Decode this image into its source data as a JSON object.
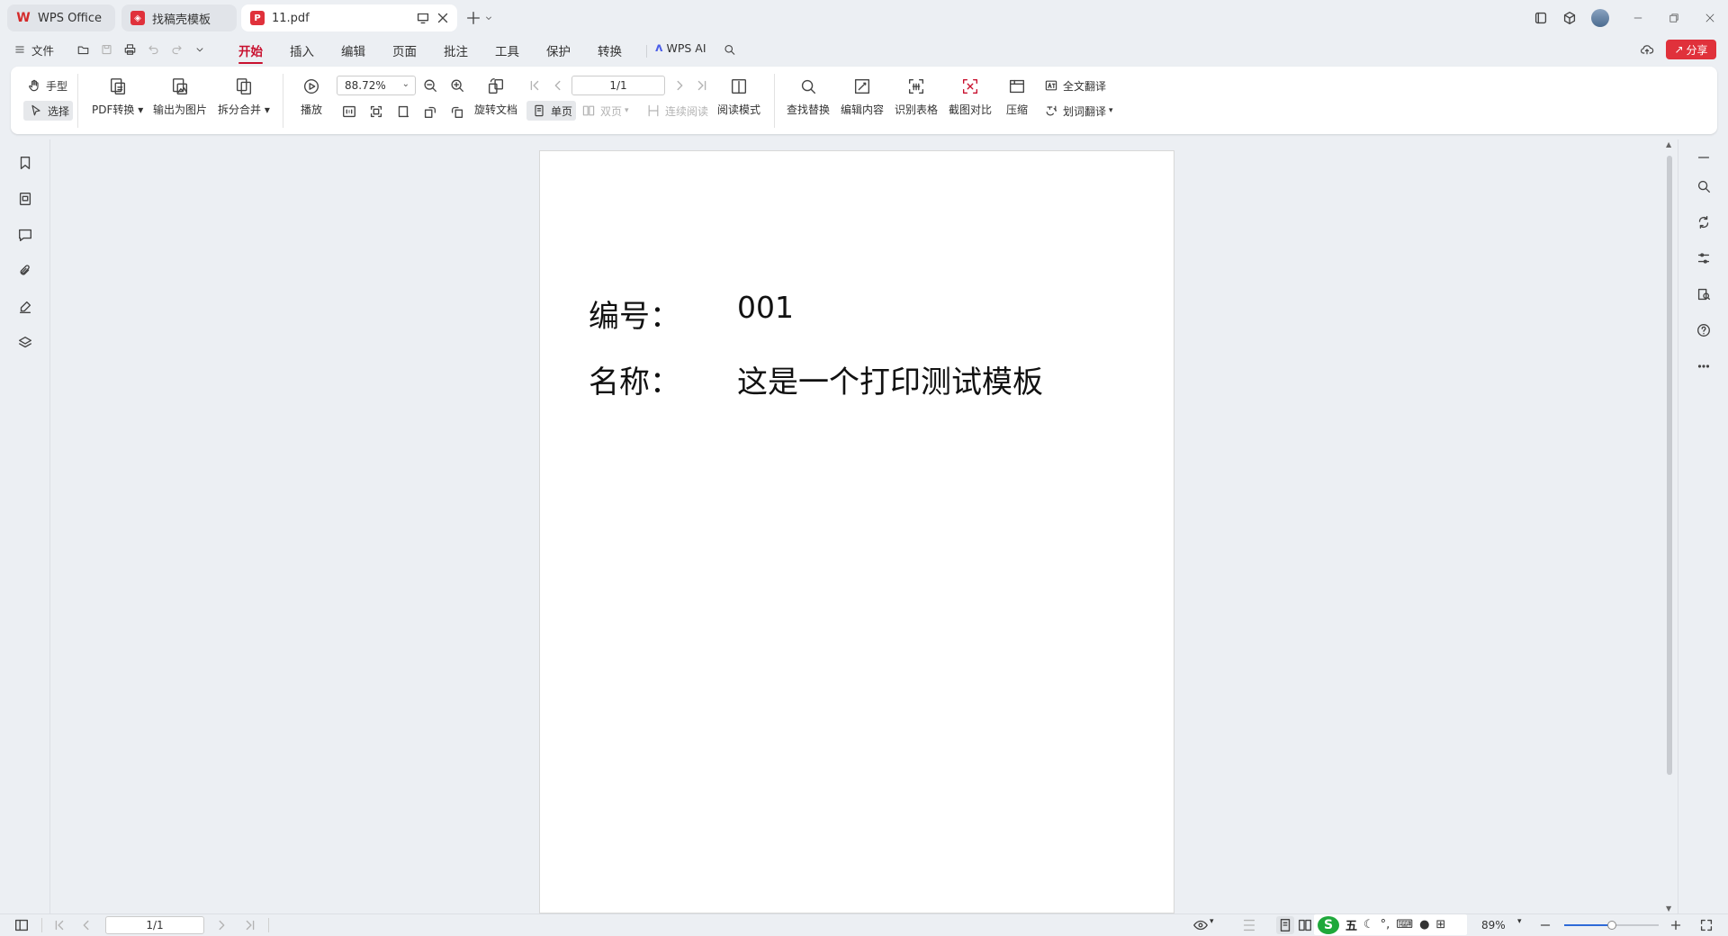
{
  "tabs": [
    {
      "label": "WPS Office",
      "logo": "W"
    },
    {
      "label": "找稿壳模板",
      "logo": "找"
    },
    {
      "label": "11.pdf",
      "logo": "P"
    }
  ],
  "menu": {
    "file": "文件",
    "items": [
      "开始",
      "插入",
      "编辑",
      "页面",
      "批注",
      "工具",
      "保护",
      "转换"
    ],
    "active": "开始",
    "ai": "WPS AI",
    "share": "分享"
  },
  "ribbon": {
    "hand": "手型",
    "select": "选择",
    "pdf_convert": "PDF转换",
    "export_image": "输出为图片",
    "split_merge": "拆分合并",
    "play": "播放",
    "zoom_value": "88.72%",
    "page_value": "1/1",
    "rotate_doc": "旋转文档",
    "single_page": "单页",
    "double_page": "双页",
    "continuous": "连续阅读",
    "read_mode": "阅读模式",
    "find_replace": "查找替换",
    "edit_content": "编辑内容",
    "recognize_table": "识别表格",
    "screenshot_compare": "截图对比",
    "compress": "压缩",
    "full_translate": "全文翻译",
    "word_translate": "划词翻译"
  },
  "document": {
    "label1": "编号：",
    "value1": "001",
    "label2": "名称：",
    "value2": "这是一个打印测试模板"
  },
  "status": {
    "page": "1/1",
    "zoom": "89%",
    "ime": "五",
    "zoom_level": 0.5
  },
  "colors": {
    "accent": "#c8102e",
    "share_bg": "#e0313b",
    "page_bg": "#ffffff"
  }
}
